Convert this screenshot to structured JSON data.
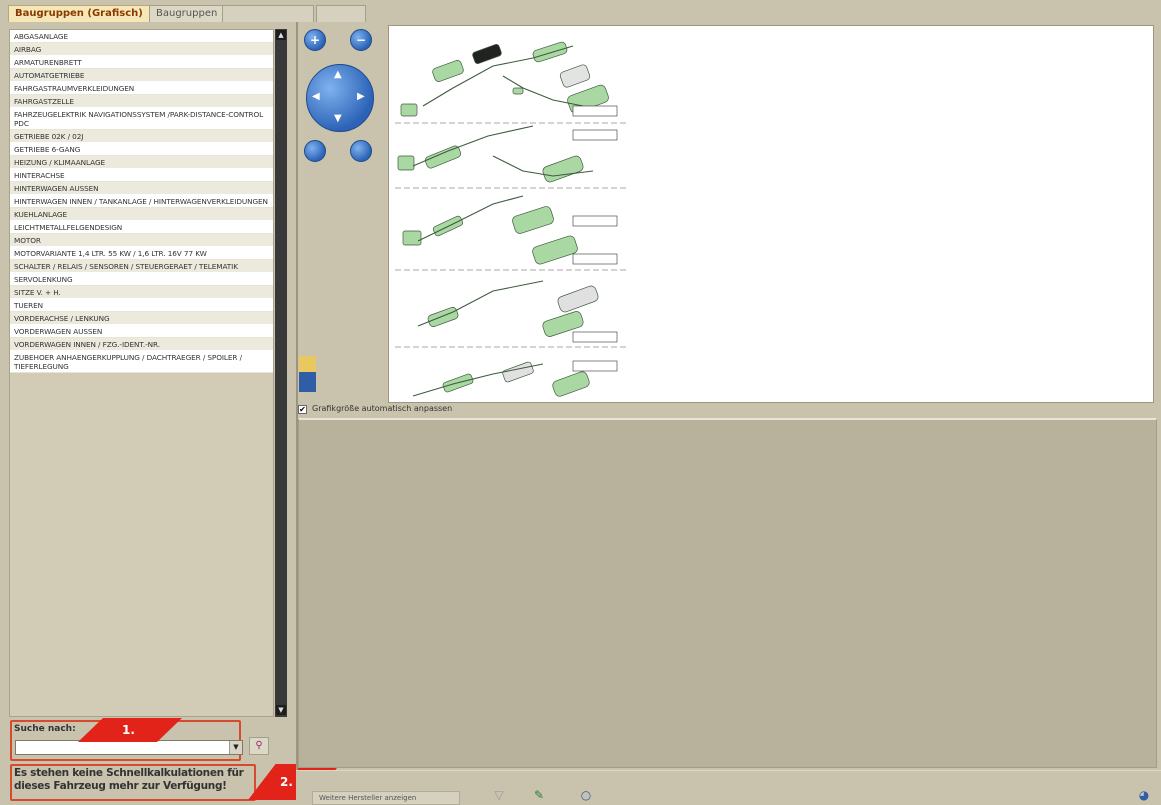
{
  "tabs": [
    {
      "label": "Baugruppen (Grafisch)",
      "state": "active"
    },
    {
      "label": "Baugruppen",
      "state": "inactive"
    },
    {
      "label": "",
      "state": "disabled"
    },
    {
      "label": "",
      "state": "disabled"
    }
  ],
  "assembly_list": [
    "ABGASANLAGE",
    "AIRBAG",
    "ARMATURENBRETT",
    "AUTOMATGETRIEBE",
    "FAHRGASTRAUMVERKLEIDUNGEN",
    "FAHRGASTZELLE",
    "FAHRZEUGELEKTRIK NAVIGATIONSSYSTEM /PARK-DISTANCE-CONTROL PDC",
    "GETRIEBE 02K / 02J",
    "GETRIEBE 6-GANG",
    "HEIZUNG / KLIMAANLAGE",
    "HINTERACHSE",
    "HINTERWAGEN AUSSEN",
    "HINTERWAGEN INNEN / TANKANLAGE / HINTERWAGENVERKLEIDUNGEN",
    "KUEHLANLAGE",
    "LEICHTMETALLFELGENDESIGN",
    "MOTOR",
    "MOTORVARIANTE 1,4 LTR. 55 KW / 1,6 LTR. 16V 77 KW",
    "SCHALTER / RELAIS / SENSOREN / STEUERGERAET / TELEMATIK",
    "SERVOLENKUNG",
    "SITZE V. + H.",
    "TUEREN",
    "VORDERACHSE / LENKUNG",
    "VORDERWAGEN AUSSEN",
    "VORDERWAGEN INNEN / FZG.-IDENT.-NR.",
    "ZUBEHOER ANHAENGERKUPPLUNG / DACHTRAEGER / SPOILER / TIEFERLEGUNG"
  ],
  "search": {
    "label": "Suche nach:",
    "value": "",
    "dropdown_glyph": "▼",
    "button_glyph": "⚲"
  },
  "callouts": {
    "first": "1.",
    "second": "2."
  },
  "notice": "Es stehen keine Schnellkalkulationen für dieses Fahrzeug mehr zur Verfügung!",
  "viewer": {
    "auto_fit_label": "Grafikgröße automatisch anpassen",
    "auto_fit_checked": true,
    "check_glyph": "✔"
  },
  "toolbar": {
    "more_manufacturers": "Weitere Hersteller anzeigen",
    "filter_glyph": "▽",
    "tool_glyph": "✎",
    "circle_glyph": "○",
    "globe_glyph": "◕"
  },
  "nav": {
    "zoom_in_glyph": "+",
    "zoom_out_glyph": "−",
    "up": "▲",
    "down": "▼",
    "left": "◀",
    "right": "▶"
  },
  "colors": {
    "highlight_border": "#d84a2f",
    "callout": "#e1231a",
    "panel": "#c9c3ad",
    "detail": "#b8b19b",
    "active_tab_text": "#8a3a00"
  }
}
